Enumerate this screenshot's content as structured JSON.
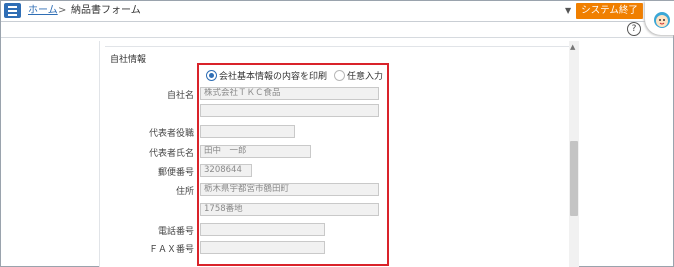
{
  "breadcrumb": {
    "home": "ホーム",
    "separator": ">",
    "current": "納品書フォーム"
  },
  "header": {
    "system_exit_label": "システム終了",
    "help_label": "?"
  },
  "form": {
    "section_title": "自社情報",
    "radio_options": [
      {
        "label": "会社基本情報の内容を印刷",
        "selected": true
      },
      {
        "label": "任意入力",
        "selected": false
      }
    ],
    "fields": {
      "company_name_label": "自社名",
      "company_name_value": "株式会社ＴＫＣ食品",
      "company_name2_value": "",
      "rep_title_label": "代表者役職",
      "rep_title_value": "",
      "rep_name_label": "代表者氏名",
      "rep_name_value": "田中　一郎",
      "postal_label": "郵便番号",
      "postal_value": "3208644",
      "address_label": "住所",
      "address1_value": "栃木県宇都宮市鶴田町",
      "address2_value": "1758番地",
      "phone_label": "電話番号",
      "phone_value": "",
      "fax_label": "ＦＡＸ番号",
      "fax_value": ""
    }
  },
  "colors": {
    "accent": "#2f6eb5",
    "exit_button": "#f07f00",
    "highlight_box": "#d9232a"
  }
}
